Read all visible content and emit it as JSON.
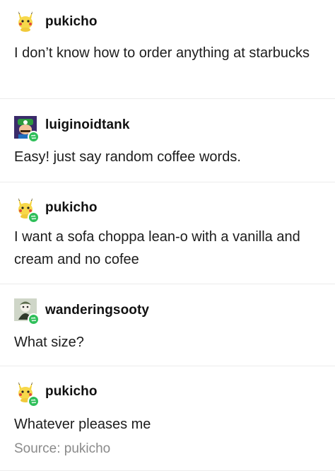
{
  "posts": [
    {
      "username": "pukicho",
      "avatar": "pikachu-icon",
      "reblog": false,
      "text": "I don’t know how to order anything at starbucks"
    },
    {
      "username": "luiginoidtank",
      "avatar": "luigi-icon",
      "reblog": true,
      "text": "Easy! just say random coffee words."
    },
    {
      "username": "pukicho",
      "avatar": "pikachu-icon",
      "reblog": true,
      "text": "I want a sofa choppa lean-o with a vanilla and cream and no cofee"
    },
    {
      "username": "wanderingsooty",
      "avatar": "character-icon",
      "reblog": true,
      "text": "What size?"
    },
    {
      "username": "pukicho",
      "avatar": "pikachu-icon",
      "reblog": true,
      "text": "Whatever pleases me"
    }
  ],
  "source": "Source: pukicho",
  "colors": {
    "reblog_badge": "#2fbf5a",
    "divider": "#ececec",
    "source_text": "#8a8a8a"
  }
}
